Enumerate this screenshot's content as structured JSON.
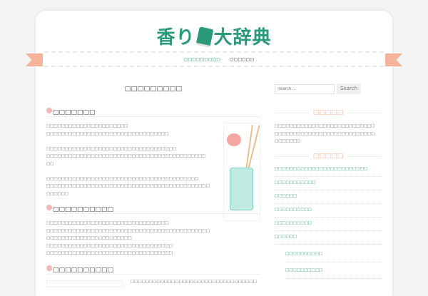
{
  "site": {
    "logo_text_1": "香り",
    "logo_text_2": "大辞典"
  },
  "nav": {
    "items": [
      "□□□□□□□□□",
      "□□□□□□"
    ],
    "separator": "·"
  },
  "main": {
    "title": "□□□□□□□□□",
    "sections": [
      {
        "heading": "□□□□□□□",
        "lines": [
          "□□□□□□□□□□□□□□□□□□□□□□",
          "□□□□□□□□□□□□□□□□□□□□□□□□□□□□□□□□□",
          "",
          "□□□□□□□□□□□□□□□□□□□□□□□□□□□□□□□□□□□",
          "□□□□□□□□□□□□□□□□□□□□□□□□□□□□□□□□□□□□□□□□□□□",
          "□□",
          "",
          "□□□□□□□□□□□□□□□□□□□□□□□□□□□□□□□□□□□□□□□□□",
          "□□□□□□□□□□□□□□□□□□□□□□□□□□□□□□□□□□□□□□□□□□□□",
          "□□□□□□"
        ]
      },
      {
        "heading": "□□□□□□□□□□",
        "lines": [
          "□□□□□□□□□□□□□□□□□□□□□□□□□□□□□□□□□",
          "□□□□□□□□□□□□□□□□□□□□□□□□□□□□□□□□□□□□□□□□□□□□",
          "□□□□□□□□□□□□□□□□□□□□□□□",
          "□□□□□□□□□□□□□□□□□□□□□□□□□□□□□□□□□□",
          "□□□□□□□□□□□□□□□□□□□□□□□□□□□□□□□□□□"
        ]
      },
      {
        "heading": "□□□□□□□□□□",
        "lines": [
          "□□□□□□□□□□□□□□□□□□□□□□□□□□□□□□□□□□"
        ]
      }
    ]
  },
  "sidebar": {
    "search_placeholder": "Search …",
    "search_button": "Search",
    "widget1_title": "□□□□□",
    "widget1_lines": [
      "□□□□□□□□□□□□□□□□□□□□□□□□□□□",
      "□□□□□□□□□□□□□□□□□□□□□□□□□□□",
      "□□□□□□□"
    ],
    "widget2_title": "□□□□□",
    "links": [
      "□□□□□□□□□□□□□□□□□□□□□□□□□",
      "□□□□□□□□□□□",
      "□□□□□□",
      "□□□□□□□□□□",
      "□□□□□□□□□□",
      "□□□□□□"
    ],
    "sub_links": [
      "□□□□□□□□□□",
      "□□□□□□□□□□"
    ]
  },
  "colors": {
    "accent": "#2a9a78",
    "ribbon": "#f5b49a"
  }
}
